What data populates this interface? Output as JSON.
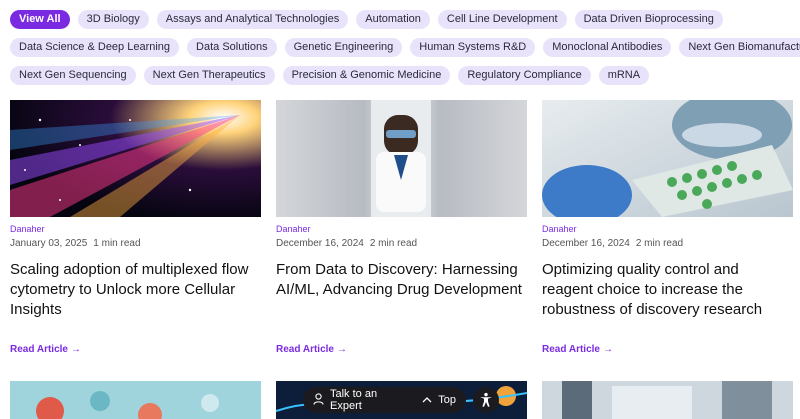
{
  "tags": {
    "row1": [
      "View All",
      "3D Biology",
      "Assays and Analytical Technologies",
      "Automation",
      "Cell Line Development",
      "Data Driven Bioprocessing"
    ],
    "row2": [
      "Data Science & Deep Learning",
      "Data Solutions",
      "Genetic Engineering",
      "Human Systems R&D",
      "Monoclonal Antibodies",
      "Next Gen Biomanufacturing"
    ],
    "row3": [
      "Next Gen Sequencing",
      "Next Gen Therapeutics",
      "Precision & Genomic Medicine",
      "Regulatory Compliance",
      "mRNA"
    ],
    "active": "View All"
  },
  "articles": [
    {
      "source": "Danaher",
      "date": "January 03, 2025",
      "read_time": "1 min read",
      "title": "Scaling adoption of multiplexed flow cytometry to Unlock more Cellular Insights",
      "cta": "Read Article"
    },
    {
      "source": "Danaher",
      "date": "December 16, 2024",
      "read_time": "2 min read",
      "title": "From Data to Discovery: Harnessing AI/ML, Advancing Drug Development",
      "cta": "Read Article"
    },
    {
      "source": "Danaher",
      "date": "December 16, 2024",
      "read_time": "2 min read",
      "title": "Optimizing quality control and reagent choice to increase the robustness of discovery research",
      "cta": "Read Article"
    }
  ],
  "floating": {
    "expert_label": "Talk to an Expert",
    "top_label": "Top"
  },
  "colors": {
    "accent": "#7a2be2",
    "tag_bg": "#e9e2fb",
    "bar_bg": "#1b1b1f"
  }
}
